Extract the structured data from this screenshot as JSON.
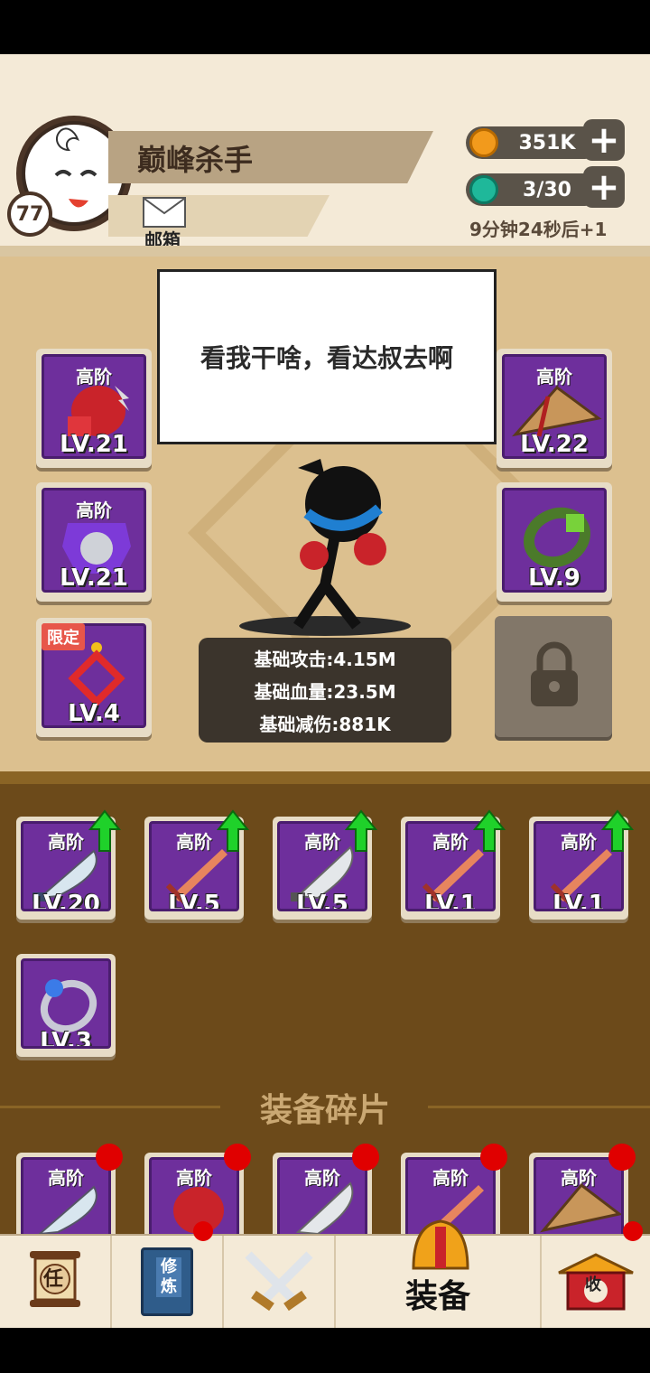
{
  "player": {
    "name": "巅峰杀手",
    "level": "77",
    "mail_label": "邮箱"
  },
  "resources": {
    "gold": "351K",
    "energy": "3/30",
    "timer": "9分钟24秒后+1"
  },
  "speech": "看我干啥，看达叔去啊",
  "equipped": {
    "left": [
      {
        "tier": "高阶",
        "level": "LV.21",
        "item": "boxing-glove"
      },
      {
        "tier": "高阶",
        "level": "LV.21",
        "item": "armor"
      },
      {
        "tier": "限定",
        "level": "LV.4",
        "item": "chinese-knot"
      }
    ],
    "right": [
      {
        "tier": "高阶",
        "level": "LV.22",
        "item": "straw-hat"
      },
      {
        "tier": "",
        "level": "LV.9",
        "item": "jade-bracelet"
      }
    ]
  },
  "stats": {
    "attack": "基础攻击:4.15M",
    "hp": "基础血量:23.5M",
    "defense": "基础减伤:881K"
  },
  "inventory": [
    {
      "tier": "高阶",
      "level": "LV.20",
      "item": "curved-blade",
      "upgrade": true
    },
    {
      "tier": "高阶",
      "level": "LV.5",
      "item": "red-sword",
      "upgrade": true
    },
    {
      "tier": "高阶",
      "level": "LV.5",
      "item": "silver-blade",
      "upgrade": true
    },
    {
      "tier": "高阶",
      "level": "LV.1",
      "item": "red-sword",
      "upgrade": true
    },
    {
      "tier": "高阶",
      "level": "LV.1",
      "item": "red-sword",
      "upgrade": true
    },
    {
      "tier": "",
      "level": "LV.3",
      "item": "ring",
      "upgrade": false
    }
  ],
  "fragments_title": "装备碎片",
  "fragments": [
    {
      "tier": "高阶",
      "item": "curved-blade"
    },
    {
      "tier": "高阶",
      "item": "boxing-glove"
    },
    {
      "tier": "高阶",
      "item": "silver-blade"
    },
    {
      "tier": "高阶",
      "item": "red-sword"
    },
    {
      "tier": "高阶",
      "item": "straw-hat"
    }
  ],
  "nav": {
    "task": "任",
    "cultivate": "修炼",
    "battle": "",
    "equip": "装备",
    "collect": "收"
  },
  "colors": {
    "slot_purple": "#6e2f9c",
    "header_bg": "#f4ead7",
    "arena_bg": "#dcc08f",
    "inventory_bg": "#6c4a1a",
    "upgrade_green": "#1fd12a",
    "notify_red": "#e00000"
  }
}
